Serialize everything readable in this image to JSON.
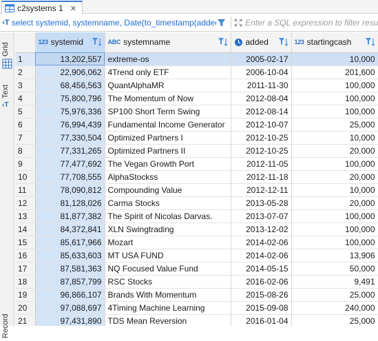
{
  "tab": {
    "title": "c2systems 1",
    "close": "✕"
  },
  "filter": {
    "query": "select systemid, systemname, Date(to_timestamp(added))",
    "placeholder": "Enter a SQL expression to filter results",
    "query_icon": "sql-query-icon"
  },
  "side": {
    "grid_label": "Grid",
    "text_label": "Text",
    "record_label": "Record"
  },
  "columns": [
    {
      "badge": "123",
      "name": "systemid"
    },
    {
      "badge": "ABC",
      "name": "systemname"
    },
    {
      "badge": "",
      "name": "added"
    },
    {
      "badge": "123",
      "name": "startingcash"
    }
  ],
  "rows": [
    {
      "n": "1",
      "id": "13,202,557",
      "name": "extreme-os",
      "added": "2005-02-17",
      "cash": "10,000"
    },
    {
      "n": "2",
      "id": "22,906,062",
      "name": "4Trend only ETF",
      "added": "2006-10-04",
      "cash": "201,600"
    },
    {
      "n": "3",
      "id": "68,456,563",
      "name": "QuantAlphaMR",
      "added": "2011-11-30",
      "cash": "100,000"
    },
    {
      "n": "4",
      "id": "75,800,796",
      "name": "The Momentum of Now",
      "added": "2012-08-04",
      "cash": "100,000"
    },
    {
      "n": "5",
      "id": "75,976,336",
      "name": "SP100 Short Term Swing",
      "added": "2012-08-14",
      "cash": "100,000"
    },
    {
      "n": "6",
      "id": "76,994,439",
      "name": "Fundamental Income Generator",
      "added": "2012-10-07",
      "cash": "25,000"
    },
    {
      "n": "7",
      "id": "77,330,504",
      "name": "Optimized Partners I",
      "added": "2012-10-25",
      "cash": "10,000"
    },
    {
      "n": "8",
      "id": "77,331,265",
      "name": "Optimized Partners II",
      "added": "2012-10-25",
      "cash": "20,000"
    },
    {
      "n": "9",
      "id": "77,477,692",
      "name": "The Vegan Growth Port",
      "added": "2012-11-05",
      "cash": "100,000"
    },
    {
      "n": "10",
      "id": "77,708,555",
      "name": "AlphaStockss",
      "added": "2012-11-18",
      "cash": "20,000"
    },
    {
      "n": "11",
      "id": "78,090,812",
      "name": "Compounding Value",
      "added": "2012-12-11",
      "cash": "10,000"
    },
    {
      "n": "12",
      "id": "81,128,026",
      "name": "Carma Stocks",
      "added": "2013-05-28",
      "cash": "20,000"
    },
    {
      "n": "13",
      "id": "81,877,382",
      "name": "The Spirit of Nicolas Darvas.",
      "added": "2013-07-07",
      "cash": "100,000"
    },
    {
      "n": "14",
      "id": "84,372,841",
      "name": "XLN Swingtrading",
      "added": "2013-12-02",
      "cash": "100,000"
    },
    {
      "n": "15",
      "id": "85,617,966",
      "name": "Mozart",
      "added": "2014-02-06",
      "cash": "100,000"
    },
    {
      "n": "16",
      "id": "85,633,603",
      "name": "MT USA FUND",
      "added": "2014-02-06",
      "cash": "13,906"
    },
    {
      "n": "17",
      "id": "87,581,363",
      "name": "NQ Focused Value Fund",
      "added": "2014-05-15",
      "cash": "50,000"
    },
    {
      "n": "18",
      "id": "87,857,799",
      "name": "RSC Stocks",
      "added": "2016-02-06",
      "cash": "9,491"
    },
    {
      "n": "19",
      "id": "96,866,107",
      "name": "Brands With Momentum",
      "added": "2015-08-26",
      "cash": "25,000"
    },
    {
      "n": "20",
      "id": "97,088,697",
      "name": "4Timing Machine Learning",
      "added": "2015-09-08",
      "cash": "240,000"
    },
    {
      "n": "21",
      "id": "97,431,890",
      "name": "TDS Mean Reversion",
      "added": "2016-01-04",
      "cash": "25,000"
    }
  ],
  "colors": {
    "accent": "#3d7fd6",
    "selected_row": "#cfe0f5",
    "sql_text": "#1c6bd1"
  }
}
